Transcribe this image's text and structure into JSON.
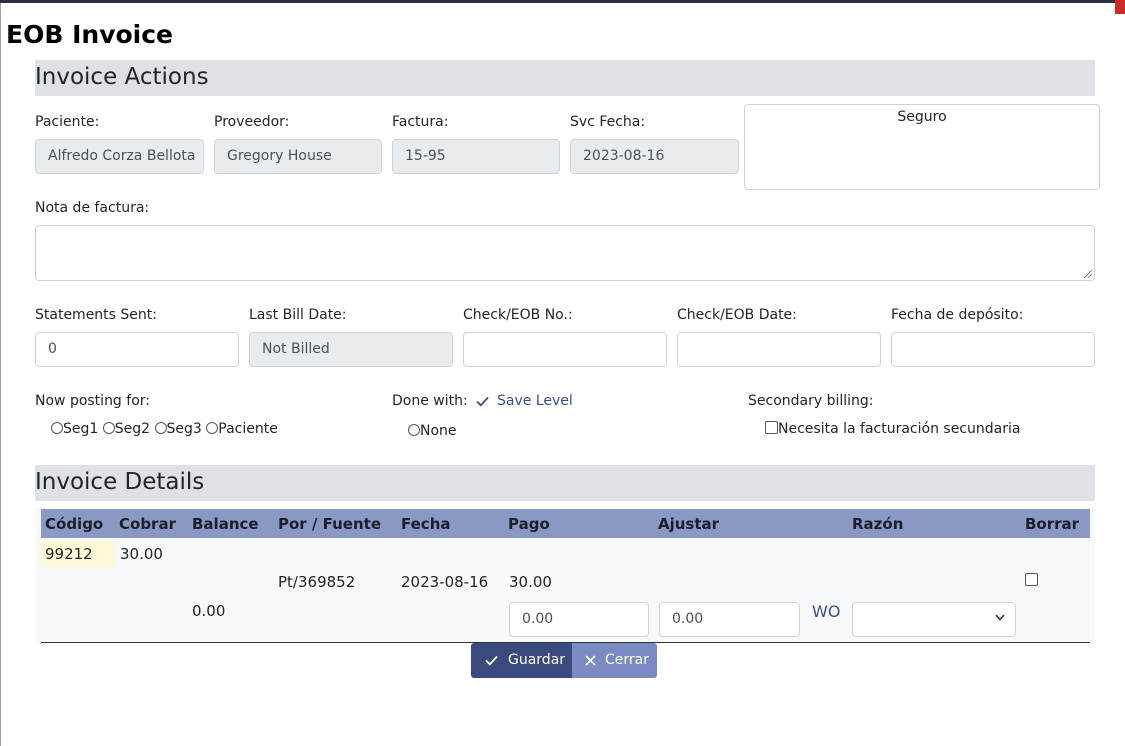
{
  "dialog": {
    "title": "EOB Invoice"
  },
  "invoice_actions": {
    "title": "Invoice Actions",
    "paciente": {
      "label": "Paciente:",
      "value": "Alfredo  Corza Bellota"
    },
    "proveedor": {
      "label": "Proveedor:",
      "value": "Gregory  House"
    },
    "factura": {
      "label": "Factura:",
      "value": "15-95"
    },
    "svc_fecha": {
      "label": "Svc Fecha:",
      "value": "2023-08-16"
    },
    "seguro": {
      "label": "Seguro"
    },
    "nota": {
      "label": "Nota de factura:",
      "value": ""
    },
    "statements_sent": {
      "label": "Statements Sent:",
      "value": "0"
    },
    "last_bill_date": {
      "label": "Last Bill Date:",
      "value": "Not Billed"
    },
    "check_eob_no": {
      "label": "Check/EOB No.:",
      "value": ""
    },
    "check_eob_date": {
      "label": "Check/EOB Date:",
      "value": ""
    },
    "fecha_deposito": {
      "label": "Fecha de depósito:",
      "value": ""
    },
    "now_posting_for": {
      "label": "Now posting for:",
      "options": [
        "Seg1",
        "Seg2",
        "Seg3",
        "Paciente"
      ]
    },
    "done_with": {
      "label": "Done with:",
      "options": [
        "None"
      ]
    },
    "save_level": {
      "label": "Save Level",
      "icon": "check-icon"
    },
    "secondary_billing": {
      "label": "Secondary billing:",
      "checkbox_label": "Necesita la facturación secundaria",
      "checked": false
    }
  },
  "invoice_details": {
    "title": "Invoice Details",
    "columns": [
      "Código",
      "Cobrar",
      "Balance",
      "Por / Fuente",
      "Fecha",
      "Pago",
      "Ajustar",
      "Razón",
      "Borrar"
    ],
    "row": {
      "codigo": "99212",
      "cobrar": "30.00",
      "por_fuente": "Pt/369852",
      "fecha": "2023-08-16",
      "pago": "30.00",
      "borrar_checked": false,
      "balance": "0.00",
      "pago_input": "0.00",
      "ajustar_input": "0.00",
      "wo_label": "WO",
      "razon_selected": ""
    }
  },
  "footer": {
    "save_label": "Guardar",
    "close_label": "Cerrar"
  },
  "colors": {
    "section_bg": "#dee2e6",
    "table_header": "#8a98c4",
    "primary_button": "#3b4a7e",
    "secondary_button": "#7a8ac2",
    "code_highlight": "#fff9d7"
  }
}
